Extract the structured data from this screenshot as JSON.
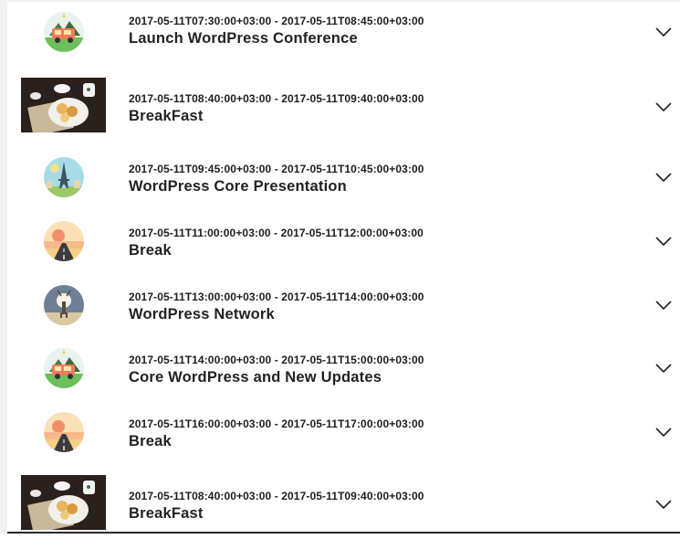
{
  "sessions": [
    {
      "time": "2017-05-11T07:30:00+03:00 - 2017-05-11T08:45:00+03:00",
      "title": "Launch WordPress Conference",
      "image": "camper-van-icon"
    },
    {
      "time": "2017-05-11T08:40:00+03:00 - 2017-05-11T09:40:00+03:00",
      "title": "BreakFast",
      "image": "breakfast-photo"
    },
    {
      "time": "2017-05-11T09:45:00+03:00 - 2017-05-11T10:45:00+03:00",
      "title": "WordPress Core Presentation",
      "image": "eiffel-tower-icon"
    },
    {
      "time": "2017-05-11T11:00:00+03:00 - 2017-05-11T12:00:00+03:00",
      "title": "Break",
      "image": "sunset-road-icon"
    },
    {
      "time": "2017-05-11T13:00:00+03:00 - 2017-05-11T14:00:00+03:00",
      "title": "WordPress Network",
      "image": "deer-icon"
    },
    {
      "time": "2017-05-11T14:00:00+03:00 - 2017-05-11T15:00:00+03:00",
      "title": "Core WordPress and New Updates",
      "image": "camper-van-icon"
    },
    {
      "time": "2017-05-11T16:00:00+03:00 - 2017-05-11T17:00:00+03:00",
      "title": "Break",
      "image": "sunset-road-icon"
    },
    {
      "time": "2017-05-11T08:40:00+03:00 - 2017-05-11T09:40:00+03:00",
      "title": "BreakFast",
      "image": "breakfast-photo"
    }
  ]
}
